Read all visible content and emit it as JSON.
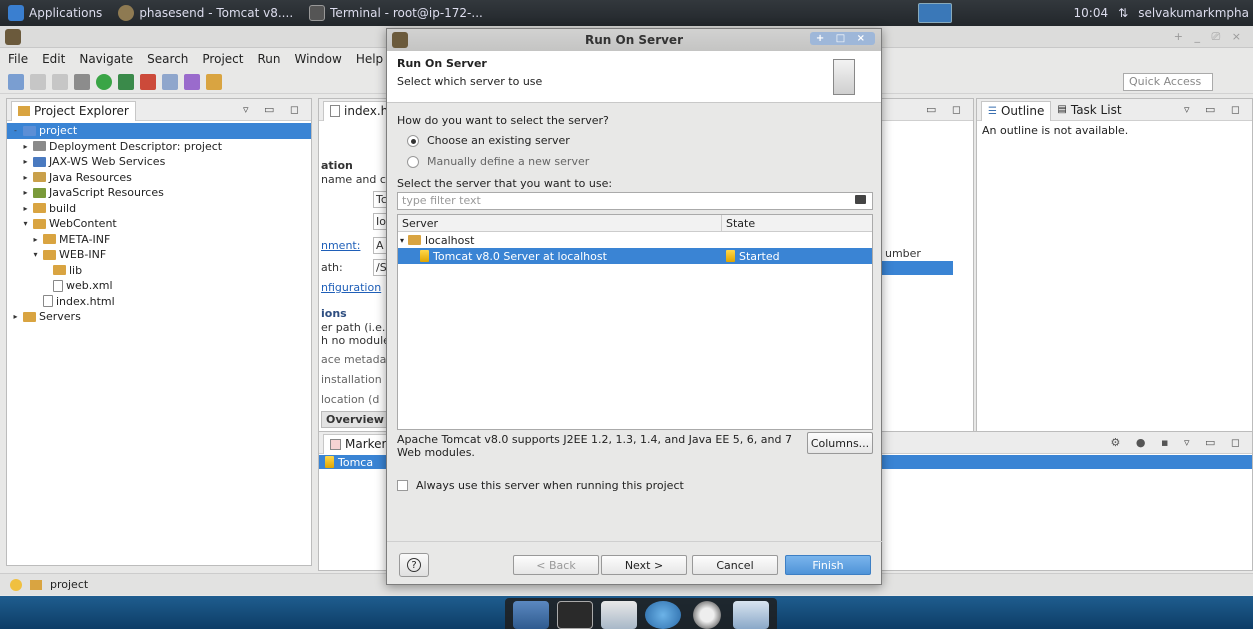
{
  "system_panel": {
    "applications": "Applications",
    "task1": "phasesend - Tomcat v8....",
    "task2": "Terminal - root@ip-172-...",
    "clock": "10:04",
    "user": "selvakumarkmpha"
  },
  "eclipse": {
    "window_controls": "+ _ ⎚ ×",
    "menu": [
      "File",
      "Edit",
      "Navigate",
      "Search",
      "Project",
      "Run",
      "Window",
      "Help"
    ],
    "quick_access": "Quick Access",
    "project_explorer": {
      "title": "Project Explorer",
      "tree": [
        {
          "label": "project",
          "level": 0,
          "twisty": "-",
          "icon": "project-icon",
          "selected": true
        },
        {
          "label": "Deployment Descriptor: project",
          "level": 1,
          "twisty": "▸",
          "icon": "descriptor-icon"
        },
        {
          "label": "JAX-WS Web Services",
          "level": 1,
          "twisty": "▸",
          "icon": "webservice-icon"
        },
        {
          "label": "Java Resources",
          "level": 1,
          "twisty": "▸",
          "icon": "java-resources-icon"
        },
        {
          "label": "JavaScript Resources",
          "level": 1,
          "twisty": "▸",
          "icon": "javascript-icon"
        },
        {
          "label": "build",
          "level": 1,
          "twisty": "▸",
          "icon": "folder-icon"
        },
        {
          "label": "WebContent",
          "level": 1,
          "twisty": "▾",
          "icon": "folder-icon"
        },
        {
          "label": "META-INF",
          "level": 2,
          "twisty": "▸",
          "icon": "folder-icon"
        },
        {
          "label": "WEB-INF",
          "level": 2,
          "twisty": "▾",
          "icon": "folder-icon"
        },
        {
          "label": "lib",
          "level": 3,
          "twisty": "",
          "icon": "folder-icon"
        },
        {
          "label": "web.xml",
          "level": 3,
          "twisty": "",
          "icon": "xml-file-icon"
        },
        {
          "label": "index.html",
          "level": 2,
          "twisty": "",
          "icon": "html-file-icon"
        },
        {
          "label": "Servers",
          "level": 0,
          "twisty": "▸",
          "icon": "folder-icon"
        }
      ]
    },
    "editor": {
      "tab": "index.ht",
      "fragments": [
        "ation",
        "name and c",
        "Tc",
        "Io",
        "nment:",
        "A",
        "ath:",
        "/S",
        "nfiguration",
        "ions",
        "er path (i.e.",
        "h no module",
        "ace metada",
        "installation",
        "location (d",
        "Overview",
        "umber"
      ]
    },
    "outline": {
      "tab1": "Outline",
      "tab2": "Task List",
      "message": "An outline is not available."
    },
    "markers": {
      "tab": "Markers",
      "row": "Tomca"
    },
    "status": "project"
  },
  "dialog": {
    "title": "Run On Server",
    "title_controls": "+ □ ×",
    "banner_title": "Run On Server",
    "banner_subtitle": "Select which server to use",
    "question": "How do you want to select the server?",
    "radio_existing": "Choose an existing server",
    "radio_manual": "Manually define a new server",
    "select_label": "Select the server that you want to use:",
    "filter_placeholder": "type filter text",
    "columns": [
      "Server",
      "State"
    ],
    "host": "localhost",
    "server_name": "Tomcat v8.0 Server at localhost",
    "server_state": "Started",
    "description": "Apache Tomcat v8.0 supports J2EE 1.2, 1.3, 1.4, and Java EE 5, 6, and 7 Web modules.",
    "columns_button": "Columns...",
    "always_use": "Always use this server when running this project",
    "help": "?",
    "back": "< Back",
    "next": "Next >",
    "cancel": "Cancel",
    "finish": "Finish"
  },
  "colors": {
    "selection": "#3a84d4",
    "finish_button": "#5a9de0",
    "panel_bg": "#33383d"
  }
}
